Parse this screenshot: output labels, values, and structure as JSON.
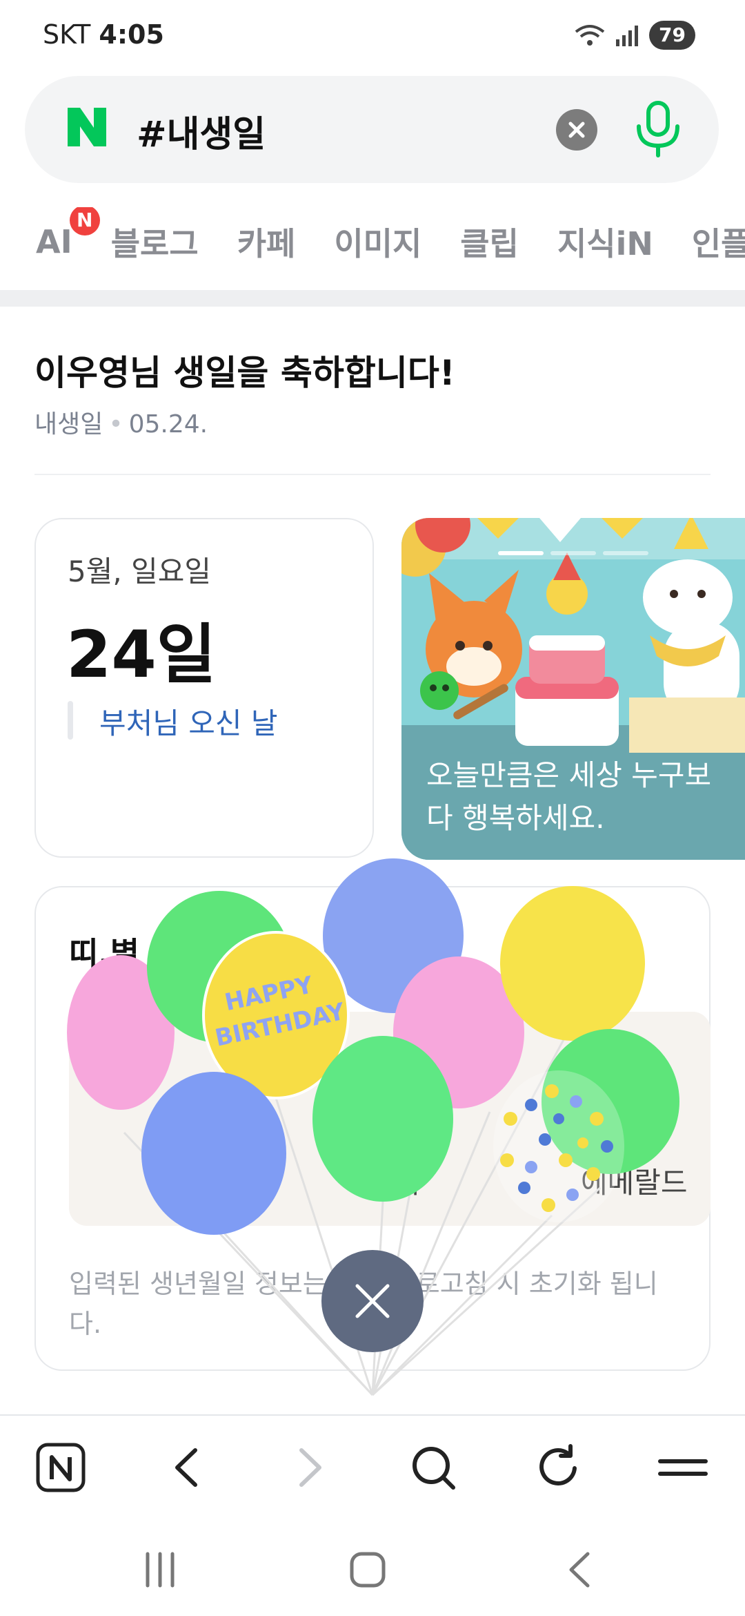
{
  "status_bar": {
    "carrier": "SKT",
    "time": "4:05",
    "battery": "79"
  },
  "search": {
    "logo_letter": "N",
    "query": "#내생일"
  },
  "tabs": [
    {
      "label": "AI",
      "badge": "N"
    },
    {
      "label": "블로그"
    },
    {
      "label": "카페"
    },
    {
      "label": "이미지"
    },
    {
      "label": "클립"
    },
    {
      "label": "지식iN"
    },
    {
      "label": "인플"
    }
  ],
  "header": {
    "title": "이우영님 생일을 축하합니다!",
    "category": "내생일",
    "date": "05.24."
  },
  "date_card": {
    "month_weekday": "5월, 일요일",
    "day": "24일",
    "holiday": "부처님 오신 날"
  },
  "illustration_card": {
    "caption": "오늘만큼은 세상 누구보다 행복하세요.",
    "slide_index": 1,
    "slide_count": 3
  },
  "zodiac_card": {
    "title": "띠,별",
    "label_constellation": "자리",
    "label_birthstone": "에메랄드",
    "note": "입력된 생년월일 정보는 또는 새로고침 시 초기화 됩니다."
  },
  "balloon": {
    "text_line1": "HAPPY",
    "text_line2": "BIRTHDAY"
  },
  "colors": {
    "naver_green": "#03c75a",
    "holiday_blue": "#2f65b8",
    "badge_red": "#f0413e",
    "fab": "#5f6a81"
  },
  "icons": {
    "bottom_nav": [
      "naver-home-icon",
      "back-icon",
      "forward-icon",
      "search-icon",
      "refresh-icon",
      "menu-icon"
    ],
    "system_nav": [
      "recents-icon",
      "home-icon",
      "system-back-icon"
    ]
  }
}
